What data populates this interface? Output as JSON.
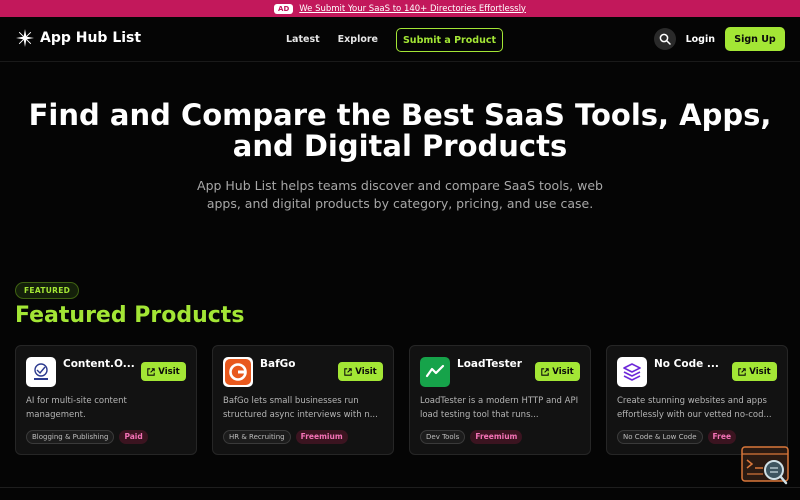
{
  "ad": {
    "badge": "AD",
    "text": "We Submit Your SaaS to 140+ Directories Effortlessly"
  },
  "nav": {
    "brand": "App Hub List",
    "links": [
      "Latest",
      "Explore"
    ],
    "submit_label": "Submit a Product",
    "login_label": "Login",
    "signup_label": "Sign Up"
  },
  "hero": {
    "title_line1": "Find and Compare the Best SaaS Tools, Apps,",
    "title_line2": "and Digital Products",
    "subtitle": "App Hub List helps teams discover and compare SaaS tools, web apps, and digital products by category, pricing, and use case."
  },
  "featured": {
    "pill": "FEATURED",
    "title": "Featured Products",
    "visit_label": "Visit",
    "products": [
      {
        "name": "Content.O...",
        "icon": "contentos-logo-icon",
        "description": "AI for multi-site content management.",
        "category": "Blogging & Publishing",
        "pricing": "Paid"
      },
      {
        "name": "BafGo",
        "icon": "bafgo-logo-icon",
        "description": "BafGo lets small businesses run structured async interviews with n...",
        "category": "HR & Recruiting",
        "pricing": "Freemium"
      },
      {
        "name": "LoadTester",
        "icon": "loadtester-logo-icon",
        "description": "LoadTester is a modern HTTP and API load testing tool that runs...",
        "category": "Dev Tools",
        "pricing": "Freemium"
      },
      {
        "name": "No Code ...",
        "icon": "nocode-logo-icon",
        "description": "Create stunning websites and apps effortlessly with our vetted no-cod...",
        "category": "No Code & Low Code",
        "pricing": "Free"
      }
    ]
  },
  "colors": {
    "accent": "#a3e635",
    "ad_bar": "#c2185b",
    "background": "#050505",
    "price_tag": "#f472b6"
  }
}
